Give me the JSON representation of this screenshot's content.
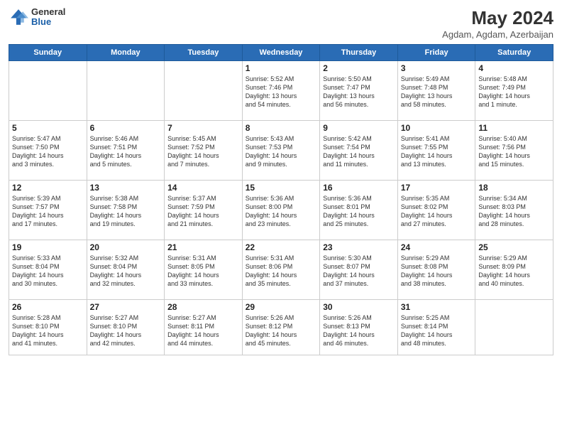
{
  "header": {
    "logo_general": "General",
    "logo_blue": "Blue",
    "month_year": "May 2024",
    "location": "Agdam, Agdam, Azerbaijan"
  },
  "days_of_week": [
    "Sunday",
    "Monday",
    "Tuesday",
    "Wednesday",
    "Thursday",
    "Friday",
    "Saturday"
  ],
  "weeks": [
    [
      {
        "day": "",
        "info": ""
      },
      {
        "day": "",
        "info": ""
      },
      {
        "day": "",
        "info": ""
      },
      {
        "day": "1",
        "info": "Sunrise: 5:52 AM\nSunset: 7:46 PM\nDaylight: 13 hours\nand 54 minutes."
      },
      {
        "day": "2",
        "info": "Sunrise: 5:50 AM\nSunset: 7:47 PM\nDaylight: 13 hours\nand 56 minutes."
      },
      {
        "day": "3",
        "info": "Sunrise: 5:49 AM\nSunset: 7:48 PM\nDaylight: 13 hours\nand 58 minutes."
      },
      {
        "day": "4",
        "info": "Sunrise: 5:48 AM\nSunset: 7:49 PM\nDaylight: 14 hours\nand 1 minute."
      }
    ],
    [
      {
        "day": "5",
        "info": "Sunrise: 5:47 AM\nSunset: 7:50 PM\nDaylight: 14 hours\nand 3 minutes."
      },
      {
        "day": "6",
        "info": "Sunrise: 5:46 AM\nSunset: 7:51 PM\nDaylight: 14 hours\nand 5 minutes."
      },
      {
        "day": "7",
        "info": "Sunrise: 5:45 AM\nSunset: 7:52 PM\nDaylight: 14 hours\nand 7 minutes."
      },
      {
        "day": "8",
        "info": "Sunrise: 5:43 AM\nSunset: 7:53 PM\nDaylight: 14 hours\nand 9 minutes."
      },
      {
        "day": "9",
        "info": "Sunrise: 5:42 AM\nSunset: 7:54 PM\nDaylight: 14 hours\nand 11 minutes."
      },
      {
        "day": "10",
        "info": "Sunrise: 5:41 AM\nSunset: 7:55 PM\nDaylight: 14 hours\nand 13 minutes."
      },
      {
        "day": "11",
        "info": "Sunrise: 5:40 AM\nSunset: 7:56 PM\nDaylight: 14 hours\nand 15 minutes."
      }
    ],
    [
      {
        "day": "12",
        "info": "Sunrise: 5:39 AM\nSunset: 7:57 PM\nDaylight: 14 hours\nand 17 minutes."
      },
      {
        "day": "13",
        "info": "Sunrise: 5:38 AM\nSunset: 7:58 PM\nDaylight: 14 hours\nand 19 minutes."
      },
      {
        "day": "14",
        "info": "Sunrise: 5:37 AM\nSunset: 7:59 PM\nDaylight: 14 hours\nand 21 minutes."
      },
      {
        "day": "15",
        "info": "Sunrise: 5:36 AM\nSunset: 8:00 PM\nDaylight: 14 hours\nand 23 minutes."
      },
      {
        "day": "16",
        "info": "Sunrise: 5:36 AM\nSunset: 8:01 PM\nDaylight: 14 hours\nand 25 minutes."
      },
      {
        "day": "17",
        "info": "Sunrise: 5:35 AM\nSunset: 8:02 PM\nDaylight: 14 hours\nand 27 minutes."
      },
      {
        "day": "18",
        "info": "Sunrise: 5:34 AM\nSunset: 8:03 PM\nDaylight: 14 hours\nand 28 minutes."
      }
    ],
    [
      {
        "day": "19",
        "info": "Sunrise: 5:33 AM\nSunset: 8:04 PM\nDaylight: 14 hours\nand 30 minutes."
      },
      {
        "day": "20",
        "info": "Sunrise: 5:32 AM\nSunset: 8:04 PM\nDaylight: 14 hours\nand 32 minutes."
      },
      {
        "day": "21",
        "info": "Sunrise: 5:31 AM\nSunset: 8:05 PM\nDaylight: 14 hours\nand 33 minutes."
      },
      {
        "day": "22",
        "info": "Sunrise: 5:31 AM\nSunset: 8:06 PM\nDaylight: 14 hours\nand 35 minutes."
      },
      {
        "day": "23",
        "info": "Sunrise: 5:30 AM\nSunset: 8:07 PM\nDaylight: 14 hours\nand 37 minutes."
      },
      {
        "day": "24",
        "info": "Sunrise: 5:29 AM\nSunset: 8:08 PM\nDaylight: 14 hours\nand 38 minutes."
      },
      {
        "day": "25",
        "info": "Sunrise: 5:29 AM\nSunset: 8:09 PM\nDaylight: 14 hours\nand 40 minutes."
      }
    ],
    [
      {
        "day": "26",
        "info": "Sunrise: 5:28 AM\nSunset: 8:10 PM\nDaylight: 14 hours\nand 41 minutes."
      },
      {
        "day": "27",
        "info": "Sunrise: 5:27 AM\nSunset: 8:10 PM\nDaylight: 14 hours\nand 42 minutes."
      },
      {
        "day": "28",
        "info": "Sunrise: 5:27 AM\nSunset: 8:11 PM\nDaylight: 14 hours\nand 44 minutes."
      },
      {
        "day": "29",
        "info": "Sunrise: 5:26 AM\nSunset: 8:12 PM\nDaylight: 14 hours\nand 45 minutes."
      },
      {
        "day": "30",
        "info": "Sunrise: 5:26 AM\nSunset: 8:13 PM\nDaylight: 14 hours\nand 46 minutes."
      },
      {
        "day": "31",
        "info": "Sunrise: 5:25 AM\nSunset: 8:14 PM\nDaylight: 14 hours\nand 48 minutes."
      },
      {
        "day": "",
        "info": ""
      }
    ]
  ]
}
